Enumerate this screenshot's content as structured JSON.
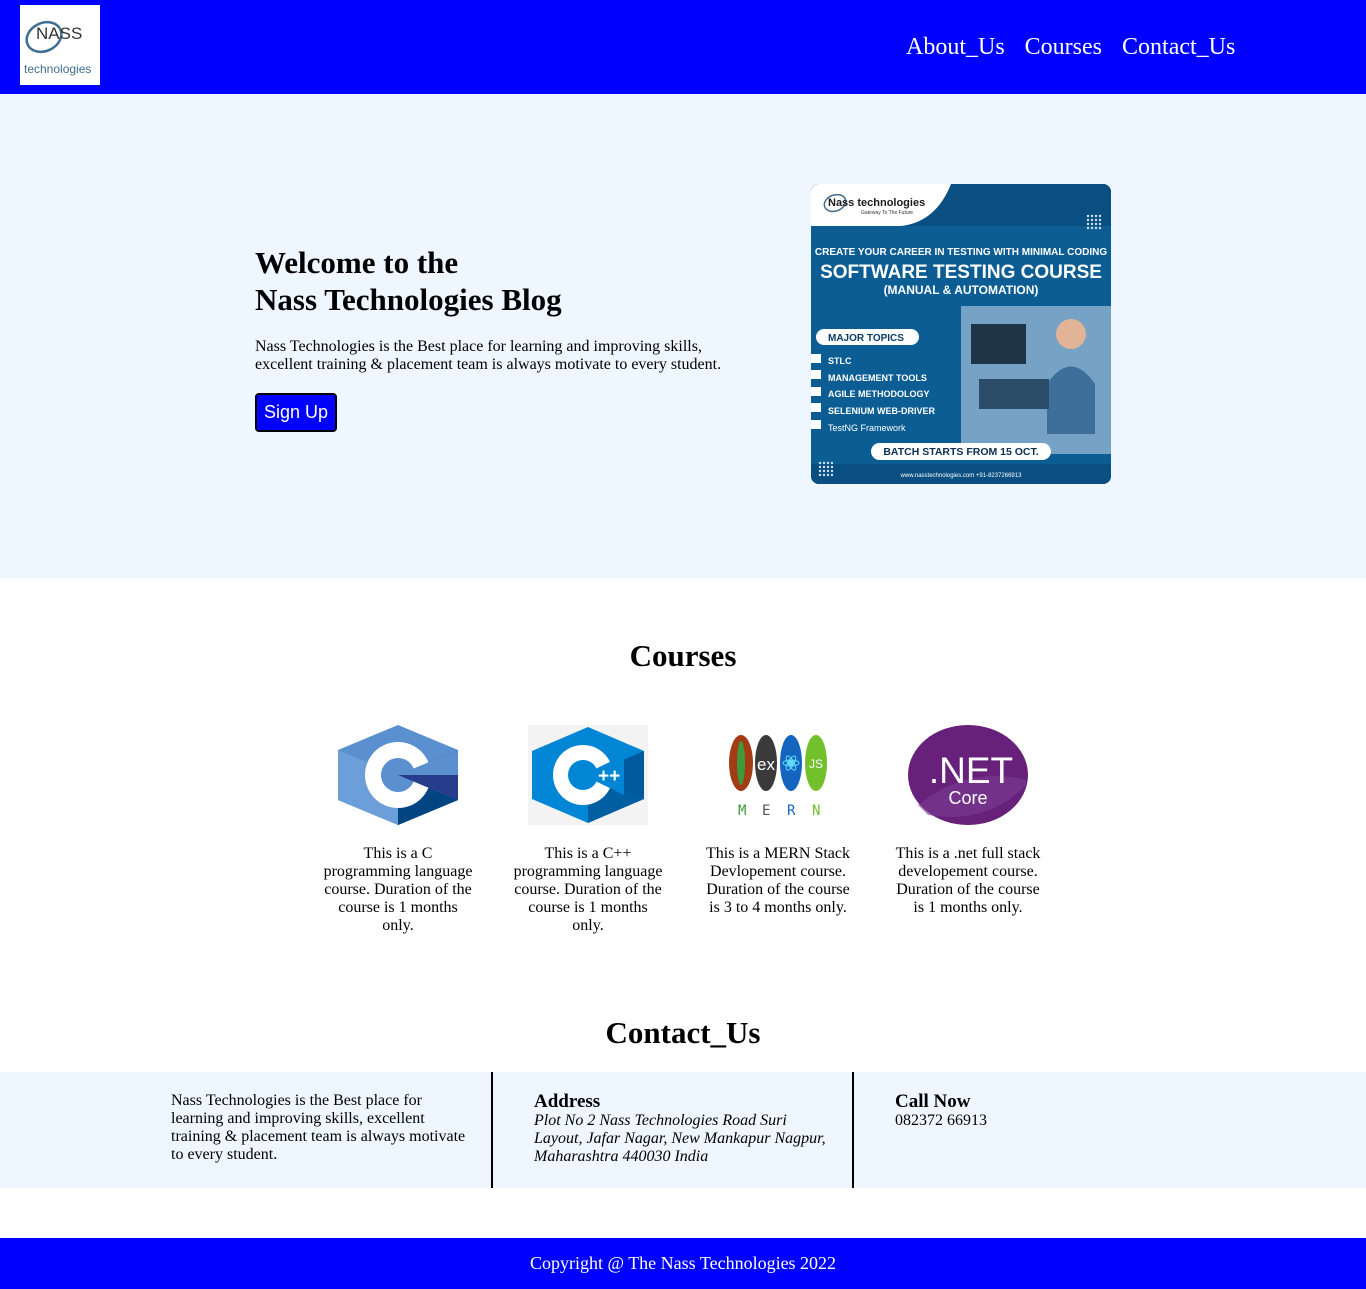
{
  "logo": {
    "name": "NASS",
    "tagline": "technologies"
  },
  "nav": {
    "links": [
      "About_Us",
      "Courses",
      "Contact_Us"
    ]
  },
  "hero": {
    "title_line1": "Welcome to the",
    "title_line2": "Nass Technologies Blog",
    "description": "Nass Technologies is the Best place for learning and improving skills, excellent training & placement team is always motivate to every student.",
    "signup_label": "Sign Up",
    "banner": {
      "brand": "Nass technologies",
      "brand_tag": "Gateway To The Future",
      "line1": "CREATE YOUR CAREER IN TESTING WITH MINIMAL CODING",
      "line2": "SOFTWARE TESTING COURSE",
      "line3": "(MANUAL & AUTOMATION)",
      "topics_head": "MAJOR TOPICS",
      "topics": [
        "STLC",
        "MANAGEMENT TOOLS",
        "AGILE METHODOLOGY",
        "SELENIUM WEB-DRIVER",
        "TestNG Framework"
      ],
      "batch": "BATCH STARTS FROM 15 OCT.",
      "contact": "www.nasstechnologies.com  +91-8237266913"
    }
  },
  "courses": {
    "title": "Courses",
    "items": [
      {
        "icon": "c-language-icon",
        "description": "This is a C programming language course. Duration of the course is 1 months only."
      },
      {
        "icon": "cpp-language-icon",
        "description": "This is a C++ programming language course. Duration of the course is 1 months only."
      },
      {
        "icon": "mern-stack-icon",
        "description": "This is a MERN Stack Devlopement course. Duration of the course is 3 to 4 months only.",
        "letters": [
          "M",
          "E",
          "R",
          "N"
        ]
      },
      {
        "icon": "dotnet-core-icon",
        "description": "This is a .net full stack developement course. Duration of the course is 1 months only.",
        "text1": ".NET",
        "text2": "Core"
      }
    ]
  },
  "contact": {
    "title": "Contact_Us",
    "about": "Nass Technologies is the Best place for learning and improving skills, excellent training & placement team is always motivate to every student.",
    "address_head": "Address",
    "address": "Plot No 2 Nass Technologies Road Suri Layout, Jafar Nagar, New Mankapur Nagpur, Maharashtra 440030 India",
    "call_head": "Call Now",
    "phone": "082372 66913"
  },
  "footer": {
    "copyright": "Copyright @ The Nass Technologies 2022"
  },
  "colors": {
    "primary": "#0000ff",
    "hero_bg": "#eef6ff"
  }
}
